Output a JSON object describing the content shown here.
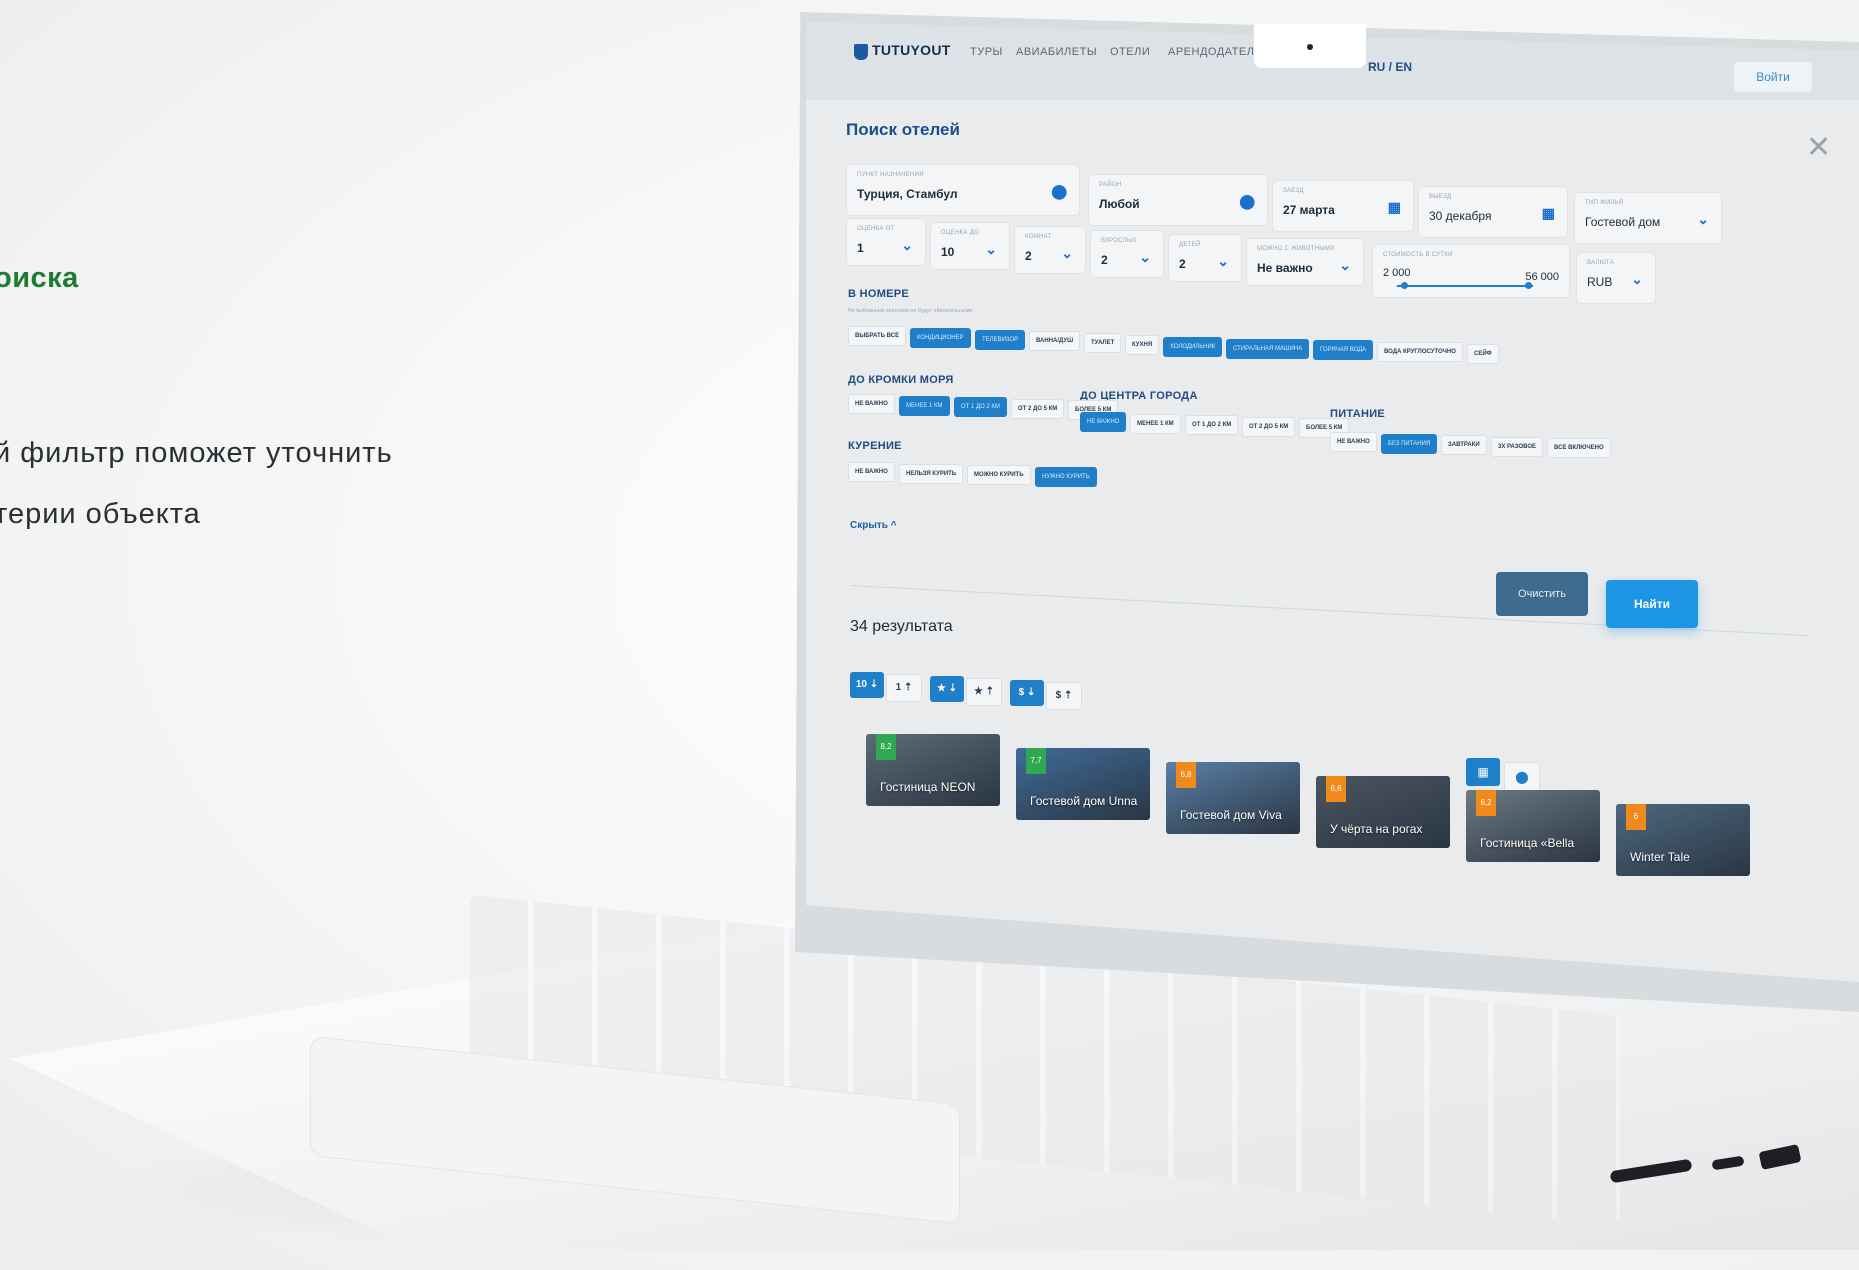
{
  "caption": {
    "title": "оиска",
    "line1": "й фильтр поможет уточнить",
    "line2": "терии объекта"
  },
  "header": {
    "logo": "TUTUYOUT",
    "nav": [
      "ТУРЫ",
      "АВИАБИЛЕТЫ",
      "ОТЕЛИ",
      "АРЕНДОДАТЕЛЯ"
    ],
    "lang": "RU / EN",
    "login": "Войти"
  },
  "search": {
    "title": "Поиск отелей",
    "close_icon": "close-icon",
    "destination": {
      "label": "Пункт назначения",
      "value": "Турция, Стамбул",
      "icon": "map-pin-icon"
    },
    "district": {
      "label": "Район",
      "value": "Любой",
      "icon": "map-pin-icon"
    },
    "checkin": {
      "label": "Заезд",
      "value": "27 марта",
      "icon": "calendar-icon"
    },
    "checkout": {
      "label": "Выезд",
      "value": "30 декабря",
      "icon": "calendar-icon"
    },
    "housing": {
      "label": "Тип жилья",
      "value": "Гостевой дом"
    },
    "rating_from": {
      "label": "Оценка от",
      "value": "1"
    },
    "rating_to": {
      "label": "Оценка до",
      "value": "10"
    },
    "rooms": {
      "label": "Комнат",
      "value": "2"
    },
    "adults": {
      "label": "Взрослых",
      "value": "2"
    },
    "children": {
      "label": "Детей",
      "value": "2"
    },
    "pets": {
      "label": "Можно с животными",
      "value": "Не важно"
    },
    "price": {
      "label": "Стоимость в сутки",
      "min": "2 000",
      "max": "56 000",
      "min_fraction": 0.05,
      "max_fraction": 0.96
    },
    "currency": {
      "label": "Валюта",
      "value": "RUB"
    }
  },
  "filters": {
    "in_room": {
      "title": "В НОМЕРЕ",
      "note": "Не выбранные критерии не будут обязательными",
      "chips": [
        {
          "label": "ВЫБРАТЬ ВСЕ",
          "on": false
        },
        {
          "label": "КОНДИЦИОНЕР",
          "on": true
        },
        {
          "label": "ТЕЛЕВИЗОР",
          "on": true
        },
        {
          "label": "ВАННА/ДУШ",
          "on": false
        },
        {
          "label": "ТУАЛЕТ",
          "on": false
        },
        {
          "label": "КУХНЯ",
          "on": false
        },
        {
          "label": "ХОЛОДИЛЬНИК",
          "on": true
        },
        {
          "label": "СТИРАЛЬНАЯ МАШИНА",
          "on": true
        },
        {
          "label": "ГОРЯЧАЯ ВОДА",
          "on": true
        },
        {
          "label": "ВОДА КРУГЛОСУТОЧНО",
          "on": false
        },
        {
          "label": "СЕЙФ",
          "on": false
        }
      ]
    },
    "sea": {
      "title": "ДО КРОМКИ МОРЯ",
      "chips": [
        {
          "label": "НЕ ВАЖНО",
          "on": false
        },
        {
          "label": "МЕНЕЕ 1 КМ",
          "on": true
        },
        {
          "label": "ОТ 1 ДО 2 КМ",
          "on": true
        },
        {
          "label": "ОТ 2 ДО 5 КМ",
          "on": false
        },
        {
          "label": "БОЛЕЕ 5 КМ",
          "on": false
        }
      ]
    },
    "center": {
      "title": "ДО ЦЕНТРА ГОРОДА",
      "chips": [
        {
          "label": "НЕ ВАЖНО",
          "on": true
        },
        {
          "label": "МЕНЕЕ 1 КМ",
          "on": false
        },
        {
          "label": "ОТ 1 ДО 2 КМ",
          "on": false
        },
        {
          "label": "ОТ 2 ДО 5 КМ",
          "on": false
        },
        {
          "label": "БОЛЕЕ 5 КМ",
          "on": false
        }
      ]
    },
    "food": {
      "title": "ПИТАНИЕ",
      "chips": [
        {
          "label": "НЕ ВАЖНО",
          "on": false
        },
        {
          "label": "БЕЗ ПИТАНИЯ",
          "on": true
        },
        {
          "label": "ЗАВТРАКИ",
          "on": false
        },
        {
          "label": "3Х РАЗОВОЕ",
          "on": false
        },
        {
          "label": "ВСЕ ВКЛЮЧЕНО",
          "on": false
        }
      ]
    },
    "smoking": {
      "title": "КУРЕНИЕ",
      "chips": [
        {
          "label": "НЕ ВАЖНО",
          "on": false
        },
        {
          "label": "НЕЛЬЗЯ КУРИТЬ",
          "on": false
        },
        {
          "label": "МОЖНО КУРИТЬ",
          "on": false
        },
        {
          "label": "НУЖНО КУРИТЬ",
          "on": true
        }
      ]
    },
    "hide_label": "Скрыть ^"
  },
  "actions": {
    "clear": "Очистить",
    "find": "Найти"
  },
  "results": {
    "count_label": "34 результата",
    "sort_buttons": [
      {
        "label": "10 ⇣",
        "on": true
      },
      {
        "label": "1 ⇡",
        "on": false
      },
      {
        "label": "★ ⇣",
        "on": true
      },
      {
        "label": "★ ⇡",
        "on": false
      },
      {
        "label": "$ ⇣",
        "on": true
      },
      {
        "label": "$ ⇡",
        "on": false
      }
    ],
    "view_icons": [
      "grid-icon",
      "map-pin-icon"
    ],
    "cards": [
      {
        "name": "Гостиница NEON",
        "score": "8,2",
        "score_color": "#2fa84f"
      },
      {
        "name": "Гостевой дом Unna",
        "score": "7,7",
        "score_color": "#2fa84f"
      },
      {
        "name": "Гостевой дом Viva",
        "score": "6,8",
        "score_color": "#f08a1c"
      },
      {
        "name": "У чёрта на рогах",
        "score": "6,6",
        "score_color": "#f08a1c"
      },
      {
        "name": "Гостиница «Bella",
        "score": "6,2",
        "score_color": "#f08a1c"
      },
      {
        "name": "Winter Tale",
        "score": "6",
        "score_color": "#f08a1c"
      }
    ]
  },
  "colors": {
    "accent": "#1f7fc9",
    "brand_green": "#1f7a33"
  }
}
